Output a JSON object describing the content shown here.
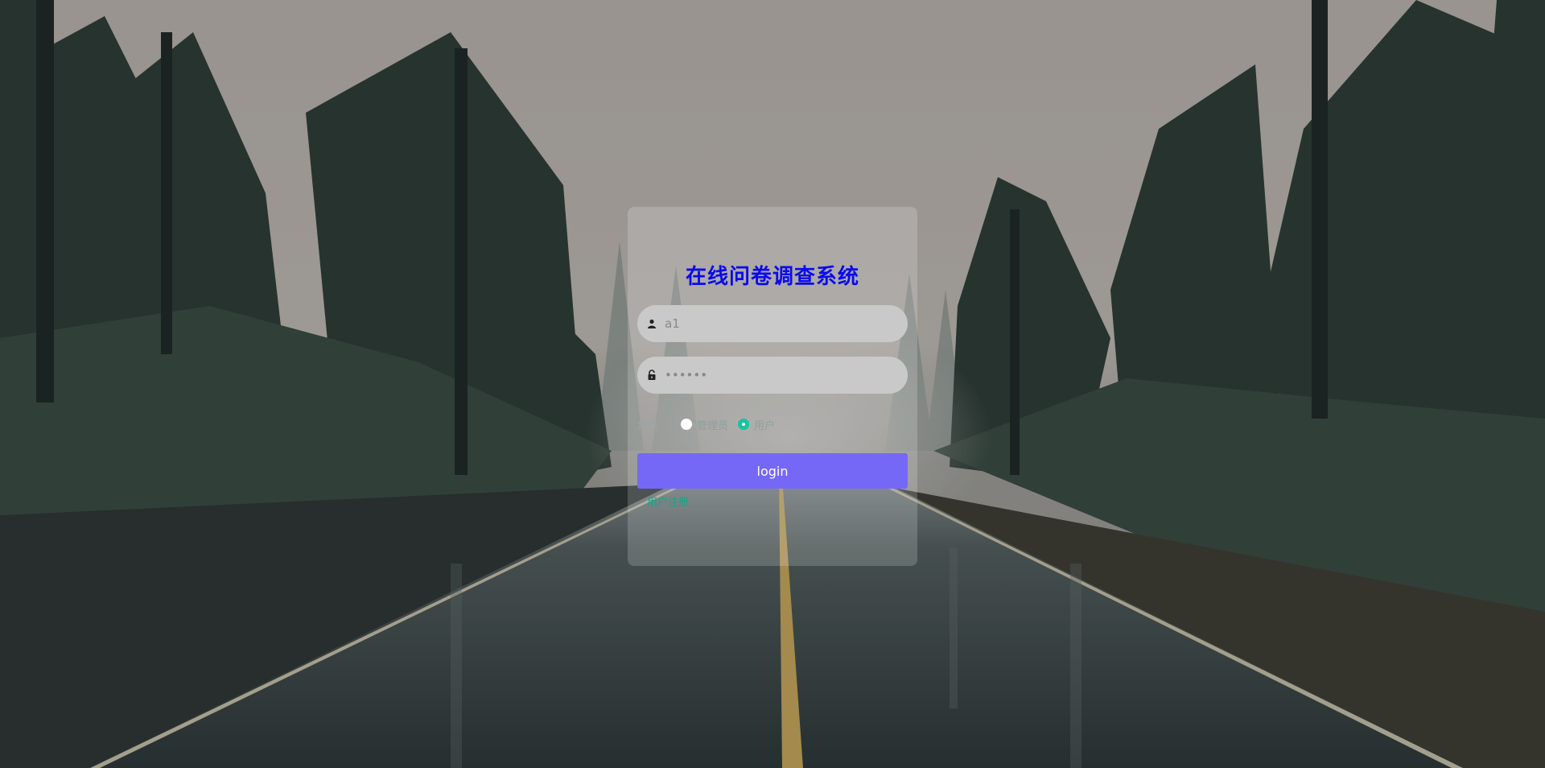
{
  "login": {
    "title": "在线问卷调查系统",
    "username": {
      "icon": "user-icon",
      "placeholder": "a1"
    },
    "password": {
      "icon": "lock-icon",
      "placeholder": "••••••"
    },
    "role": {
      "label": "角色",
      "options": [
        {
          "label": "管理员",
          "checked": false
        },
        {
          "label": "用户",
          "checked": true
        }
      ]
    },
    "submit_label": "login",
    "register_link": "用户注册"
  },
  "colors": {
    "title": "#0a0aee",
    "button": "#7568f7",
    "radio_checked": "#14c5a0",
    "link": "#14a58a",
    "input_bg": "#c9c9c9"
  },
  "background": {
    "description_icon": "forest-road-background"
  }
}
